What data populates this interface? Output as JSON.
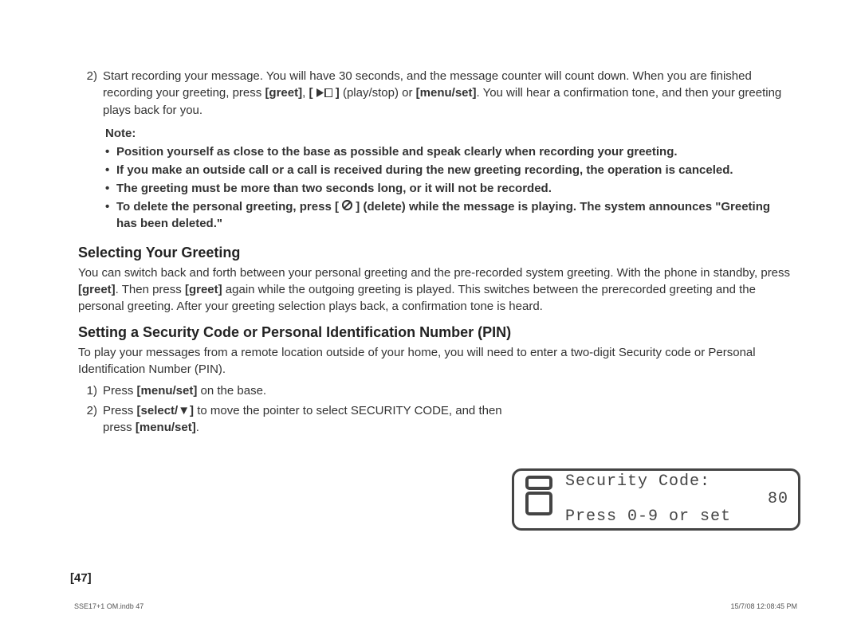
{
  "step2": {
    "num": "2)",
    "part1": "Start recording your message. You will have 30 seconds, and the message counter will count down. When you are finished recording your greeting, press ",
    "greet": "[greet]",
    "comma": ", ",
    "bracket_open": "[ ",
    "bracket_close": " ]",
    "playstop": " (play/stop) or ",
    "menuset": "[menu/set]",
    "part2": ". You will hear a confirmation tone, and then your greeting plays back for you."
  },
  "note": {
    "label": "Note:",
    "items": [
      "Position yourself as close to the base as possible and speak clearly when recording your greeting.",
      "If you make an outside call or a call is received during the new greeting recording, the operation is canceled.",
      "The greeting must be more than two seconds long, or it will not be recorded."
    ],
    "item4_a": "To delete the personal greeting, press [ ",
    "item4_b": " ] (delete) while the message is playing. The system announces \"Greeting has been deleted.\""
  },
  "section1": {
    "heading": "Selecting Your Greeting",
    "para_a": "You can switch back and forth between your personal greeting and the pre-recorded system greeting. With the phone in standby, press ",
    "greet": "[greet]",
    "para_b": ". Then press ",
    "para_c": " again while the outgoing greeting is played. This switches between the prerecorded greeting and the personal greeting. After your greeting selection plays back, a confirmation tone is heard."
  },
  "section2": {
    "heading": "Setting a Security Code or Personal Identification Number (PIN)",
    "para": "To play your messages from a remote location outside of your home, you will need to enter a two-digit Security code or Personal Identification Number (PIN).",
    "step1": {
      "num": "1)",
      "a": "Press ",
      "menuset": "[menu/set]",
      "b": " on the base."
    },
    "step2": {
      "num": "2)",
      "a": "Press ",
      "select": "[select/▼]",
      "b": " to move the pointer to select SECURITY CODE, and then press ",
      "menuset": "[menu/set]",
      "c": "."
    }
  },
  "lcd": {
    "line1": "Security Code:",
    "num": "80",
    "line2": "Press 0-9 or set"
  },
  "page_num": "[47]",
  "footer_left": "SSE17+1 OM.indb   47",
  "footer_right": "15/7/08   12:08:45 PM"
}
